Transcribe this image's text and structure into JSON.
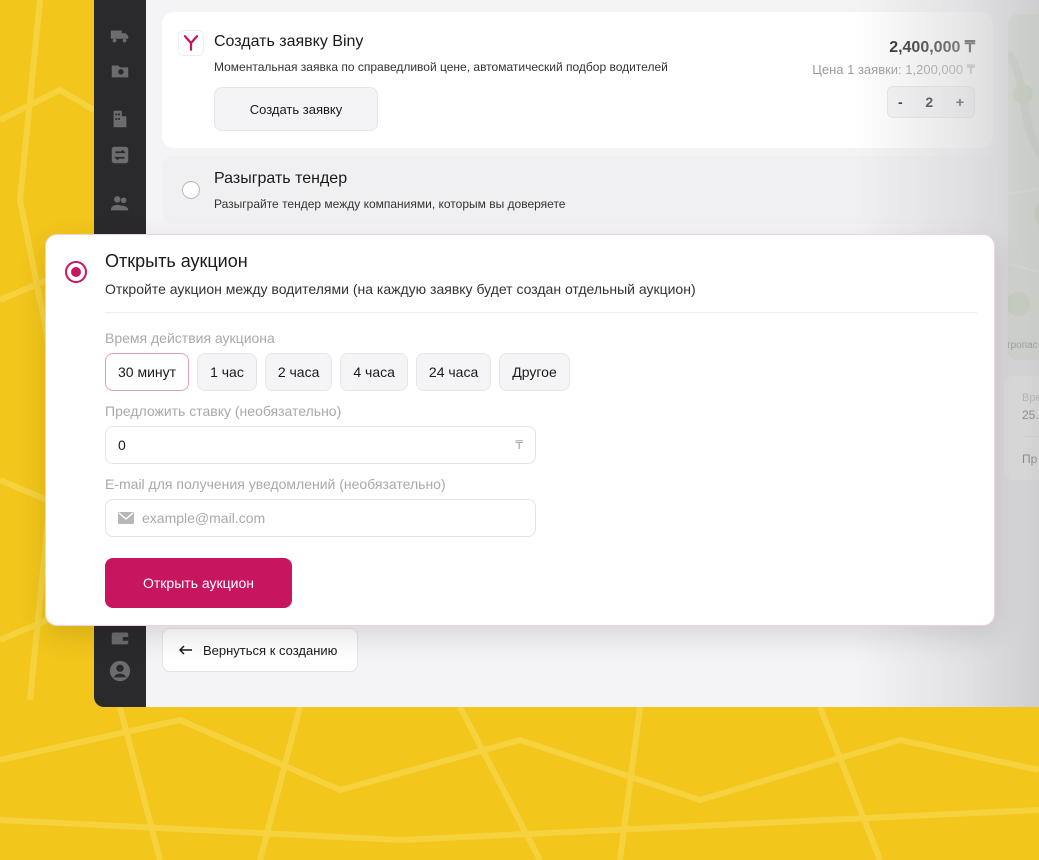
{
  "biny_card": {
    "title": "Создать заявку Biny",
    "subtitle": "Моментальная заявка по справедливой цене, автоматический подбор водителей",
    "price": "2,400,000 ₸",
    "unit_price": "Цена 1 заявки: 1,200,000 ₸",
    "create_button": "Создать заявку",
    "stepper": {
      "minus": "-",
      "value": "2",
      "plus": "+"
    }
  },
  "tender_card": {
    "title": "Разыграть тендер",
    "subtitle": "Разыграйте тендер между компаниями, которым вы доверяете"
  },
  "auction_card": {
    "title": "Открыть аукцион",
    "subtitle": "Откройте аукцион между водителями (на каждую заявку будет создан отдельный аукцион)",
    "duration_label": "Время действия аукциона",
    "durations": [
      "30 минут",
      "1 час",
      "2 часа",
      "4 часа",
      "24 часа",
      "Другое"
    ],
    "selected_duration": "30 минут",
    "bid_label": "Предложить ставку (необязательно)",
    "bid_value": "0",
    "currency_symbol": "₸",
    "email_label": "E-mail для получения уведомлений (необязательно)",
    "email_placeholder": "example@mail.com",
    "submit_button": "Открыть аукцион"
  },
  "right_panel": {
    "map_label": "тропас",
    "info_label_1": "Вре",
    "info_value_1": "25.",
    "info_label_2": "Пр"
  },
  "back_button": "Вернуться к созданию",
  "colors": {
    "accent": "#c8155f",
    "background_yellow": "#f2c61a",
    "sidebar": "#2a2a2c"
  },
  "sidebar_icons": [
    "truck-icon",
    "folder-icon",
    "building-icon",
    "exchange-icon",
    "users-icon",
    "wallet-icon",
    "user-avatar-icon"
  ]
}
